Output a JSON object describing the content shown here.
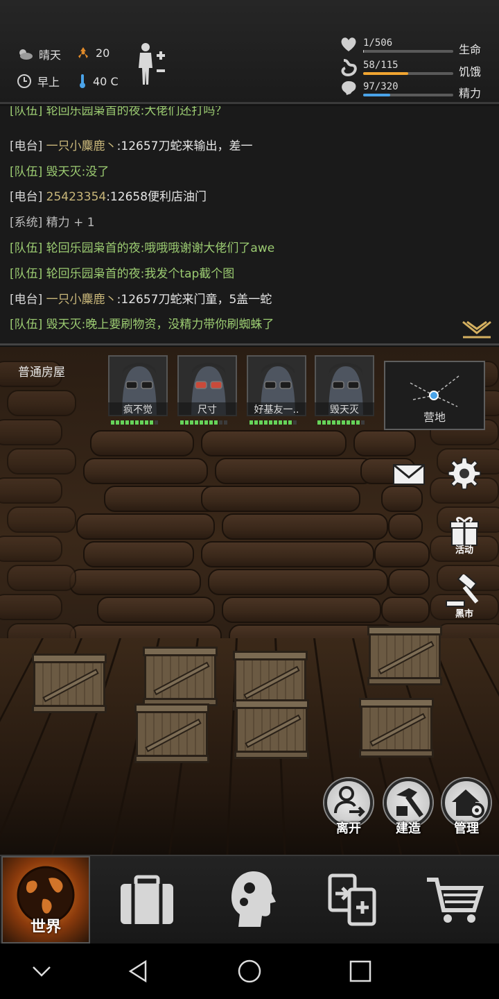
{
  "hud": {
    "weather": "晴天",
    "radiation": "20",
    "time_of_day": "早上",
    "temperature": "40 C",
    "stats": [
      {
        "value": "1/506",
        "label": "生命",
        "fraction": 0.002,
        "color": "#cfcfcf"
      },
      {
        "value": "58/115",
        "label": "饥饿",
        "fraction": 0.5,
        "color": "#f0a531"
      },
      {
        "value": "97/320",
        "label": "精力",
        "fraction": 0.3,
        "color": "#4aa3e8"
      }
    ]
  },
  "chat": {
    "lines": [
      {
        "tag": "[队伍]",
        "sender": "轮回乐园枭首的夜",
        "msg": ":大佬们还打吗？",
        "type": "team"
      },
      {
        "tag": "[电台]",
        "sender": "一只小麋鹿丶",
        "msg": ":12657刀蛇来输出，差一",
        "type": "radio"
      },
      {
        "tag": "[队伍]",
        "sender": "毁天灭",
        "msg": ":没了",
        "type": "team"
      },
      {
        "tag": "[电台]",
        "sender": "25423354",
        "msg": ":12658便利店油门",
        "type": "radio"
      },
      {
        "tag": "[系统]",
        "sender": "",
        "msg": "精力 + 1",
        "type": "system"
      },
      {
        "tag": "[队伍]",
        "sender": "轮回乐园枭首的夜",
        "msg": ":哦哦哦谢谢大佬们了awe",
        "type": "team"
      },
      {
        "tag": "[队伍]",
        "sender": "轮回乐园枭首的夜",
        "msg": ":我发个tap截个图",
        "type": "team"
      },
      {
        "tag": "[电台]",
        "sender": "一只小麋鹿丶",
        "msg": ":12657刀蛇来门童，5盖一蛇",
        "type": "radio"
      },
      {
        "tag": "[队伍]",
        "sender": "毁天灭",
        "msg": ":晚上要刷物资，没精力带你刷蜘蛛了",
        "type": "team"
      }
    ]
  },
  "scene": {
    "room_name": "普通房屋",
    "members": [
      {
        "name": "疯不觉",
        "hp_fraction": 0.85
      },
      {
        "name": "尺寸",
        "hp_fraction": 0.75
      },
      {
        "name": "好基友一..",
        "hp_fraction": 0.85
      },
      {
        "name": "毁天灭",
        "hp_fraction": 0.9
      }
    ],
    "camp_label": "营地",
    "side_buttons": {
      "mail_icon": "envelope-icon",
      "settings_icon": "gear-icon",
      "events_label": "活动",
      "black_market_label": "黑市"
    },
    "actions": {
      "leave": "离开",
      "build": "建造",
      "manage": "管理"
    }
  },
  "nav": {
    "world": "世界",
    "items": [
      "backpack-icon",
      "skills-icon",
      "trade-icon",
      "cart-icon"
    ]
  }
}
